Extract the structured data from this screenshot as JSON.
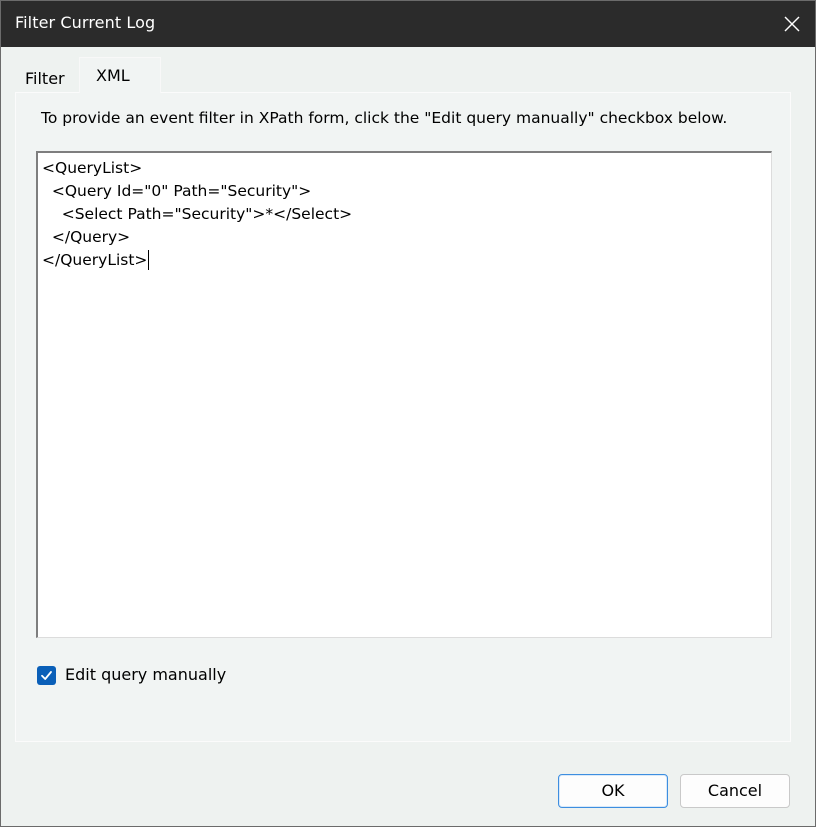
{
  "window": {
    "title": "Filter Current Log",
    "close_icon": "close-icon"
  },
  "tabs": [
    {
      "label": "Filter",
      "selected": false
    },
    {
      "label": "XML",
      "selected": true
    }
  ],
  "xml_tab": {
    "hint": "To provide an event filter in XPath form, click the \"Edit query manually\" checkbox below.",
    "query_lines": [
      "<QueryList>",
      "  <Query Id=\"0\" Path=\"Security\">",
      "    <Select Path=\"Security\">*</Select>",
      "  </Query>",
      "</QueryList>"
    ],
    "edit_manually": {
      "label": "Edit query manually",
      "checked": true
    }
  },
  "buttons": {
    "ok": "OK",
    "cancel": "Cancel"
  },
  "colors": {
    "titlebar": "#2b2b2b",
    "accent": "#0a5fb8"
  }
}
